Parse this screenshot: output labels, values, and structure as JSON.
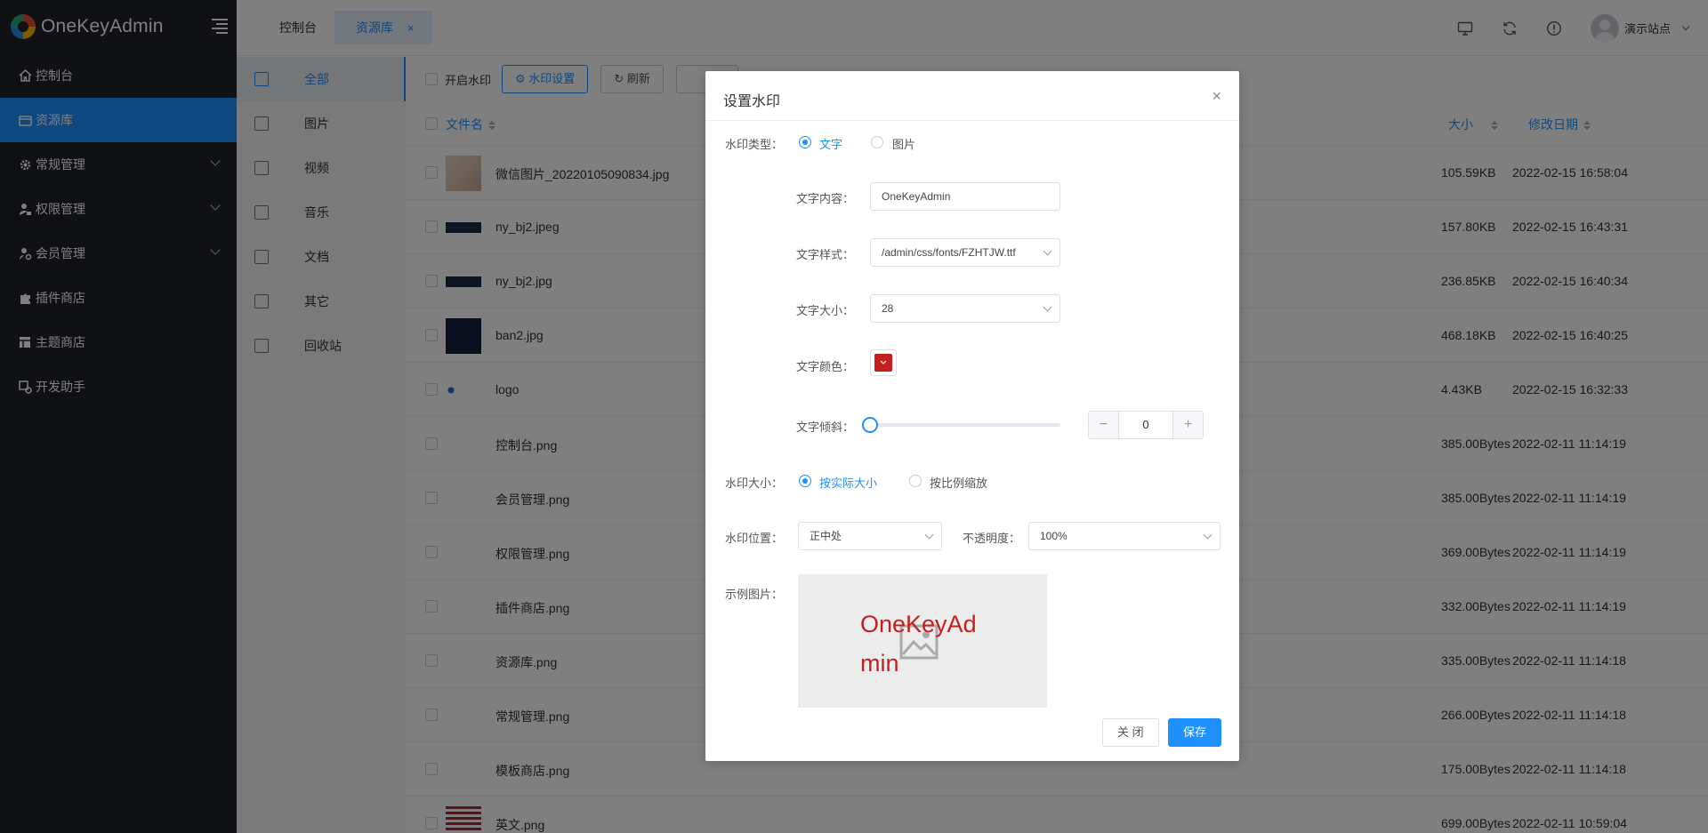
{
  "app": {
    "title": "OneKeyAdmin"
  },
  "sidebar": {
    "items": [
      {
        "label": "控制台",
        "icon": "home-icon",
        "active": false,
        "has_children": false
      },
      {
        "label": "资源库",
        "icon": "folder-icon",
        "active": true,
        "has_children": false
      },
      {
        "label": "常规管理",
        "icon": "gear-icon",
        "active": false,
        "has_children": true
      },
      {
        "label": "权限管理",
        "icon": "user-lock-icon",
        "active": false,
        "has_children": true
      },
      {
        "label": "会员管理",
        "icon": "user-gear-icon",
        "active": false,
        "has_children": true
      },
      {
        "label": "插件商店",
        "icon": "puzzle-icon",
        "active": false,
        "has_children": false
      },
      {
        "label": "主题商店",
        "icon": "layout-icon",
        "active": false,
        "has_children": false
      },
      {
        "label": "开发助手",
        "icon": "dev-icon",
        "active": false,
        "has_children": false
      }
    ]
  },
  "tabs": {
    "home": "控制台",
    "active": "资源库",
    "close_symbol": "×"
  },
  "header": {
    "user_name": "演示站点"
  },
  "categories": [
    {
      "label": "全部",
      "active": true
    },
    {
      "label": "图片",
      "active": false
    },
    {
      "label": "视频",
      "active": false
    },
    {
      "label": "音乐",
      "active": false
    },
    {
      "label": "文档",
      "active": false
    },
    {
      "label": "其它",
      "active": false
    },
    {
      "label": "回收站",
      "active": false
    }
  ],
  "toolbar": {
    "enable_watermark": "开启水印",
    "watermark_settings": "水印设置",
    "refresh": "刷新"
  },
  "table": {
    "col_name": "文件名",
    "col_size": "大小",
    "col_date": "修改日期",
    "rows": [
      {
        "name": "微信图片_20220105090834.jpg",
        "size": "105.59KB",
        "date": "2022-02-15 16:58:04",
        "thumb": "photo"
      },
      {
        "name": "ny_bj2.jpeg",
        "size": "157.80KB",
        "date": "2022-02-15 16:43:31",
        "thumb": "dark-strip"
      },
      {
        "name": "ny_bj2.jpg",
        "size": "236.85KB",
        "date": "2022-02-15 16:40:34",
        "thumb": "dark-strip"
      },
      {
        "name": "ban2.jpg",
        "size": "468.18KB",
        "date": "2022-02-15 16:40:25",
        "thumb": "dark"
      },
      {
        "name": "logo",
        "size": "4.43KB",
        "date": "2022-02-15 16:32:33",
        "thumb": "dot"
      },
      {
        "name": "控制台.png",
        "size": "385.00Bytes",
        "date": "2022-02-11 11:14:19",
        "thumb": "none"
      },
      {
        "name": "会员管理.png",
        "size": "385.00Bytes",
        "date": "2022-02-11 11:14:19",
        "thumb": "none"
      },
      {
        "name": "权限管理.png",
        "size": "369.00Bytes",
        "date": "2022-02-11 11:14:19",
        "thumb": "none"
      },
      {
        "name": "插件商店.png",
        "size": "332.00Bytes",
        "date": "2022-02-11 11:14:19",
        "thumb": "none"
      },
      {
        "name": "资源库.png",
        "size": "335.00Bytes",
        "date": "2022-02-11 11:14:18",
        "thumb": "none"
      },
      {
        "name": "常规管理.png",
        "size": "266.00Bytes",
        "date": "2022-02-11 11:14:18",
        "thumb": "none"
      },
      {
        "name": "模板商店.png",
        "size": "175.00Bytes",
        "date": "2022-02-11 11:14:18",
        "thumb": "none"
      },
      {
        "name": "英文.png",
        "size": "699.00Bytes",
        "date": "2022-02-11 10:59:04",
        "thumb": "flag"
      }
    ]
  },
  "modal": {
    "title": "设置水印",
    "close_symbol": "×",
    "type_label": "水印类型：",
    "type_options": [
      "文字",
      "图片"
    ],
    "type_selected": 0,
    "text_content_label": "文字内容：",
    "text_content_value": "OneKeyAdmin",
    "text_style_label": "文字样式：",
    "text_style_value": "/admin/css/fonts/FZHTJW.ttf",
    "text_size_label": "文字大小：",
    "text_size_value": "28",
    "text_color_label": "文字颜色：",
    "text_color_value": "#c41f1f",
    "text_tilt_label": "文字倾斜：",
    "text_tilt_value": "0",
    "stepper_minus": "−",
    "stepper_plus": "+",
    "size_label": "水印大小：",
    "size_options": [
      "按实际大小",
      "按比例缩放"
    ],
    "size_selected": 0,
    "position_label": "水印位置：",
    "position_value": "正中处",
    "opacity_label": "不透明度：",
    "opacity_value": "100%",
    "preview_label": "示例图片：",
    "preview_text": "OneKeyAdmin",
    "cancel": "关 闭",
    "save": "保存"
  },
  "colors": {
    "accent": "#1e90ff",
    "sidebar_bg": "#1f2229",
    "watermark": "#c41f1f"
  }
}
